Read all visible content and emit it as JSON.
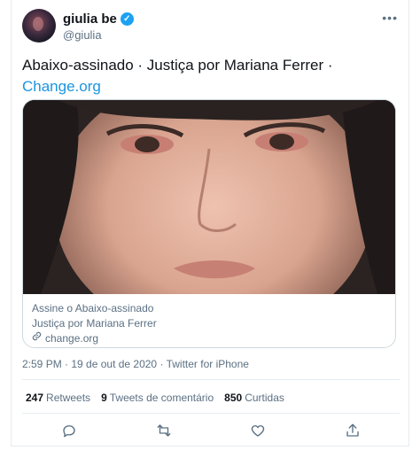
{
  "user": {
    "name": "giulia be",
    "handle": "@giulia"
  },
  "tweet": {
    "text": "Abaixo-assinado · Justiça por Mariana Ferrer ·",
    "link": "Change.org"
  },
  "card": {
    "line1": "Assine o Abaixo-assinado",
    "line2": "Justiça por Mariana Ferrer",
    "url": "change.org"
  },
  "meta": {
    "timestamp": "2:59 PM · 19 de out de 2020 · ",
    "source": "Twitter for iPhone"
  },
  "stats": [
    {
      "count": "247",
      "label": "Retweets"
    },
    {
      "count": "9",
      "label": "Tweets de comentário"
    },
    {
      "count": "850",
      "label": "Curtidas"
    }
  ],
  "icons": {
    "verified": "verified-badge-icon",
    "more": "more-options-icon",
    "reply": "reply-icon",
    "retweet": "retweet-icon",
    "like": "heart-icon",
    "share": "share-icon",
    "link": "link-icon"
  },
  "colors": {
    "accent": "#1da1f2",
    "link": "#1b95e0",
    "secondary_text": "#5b7083"
  }
}
